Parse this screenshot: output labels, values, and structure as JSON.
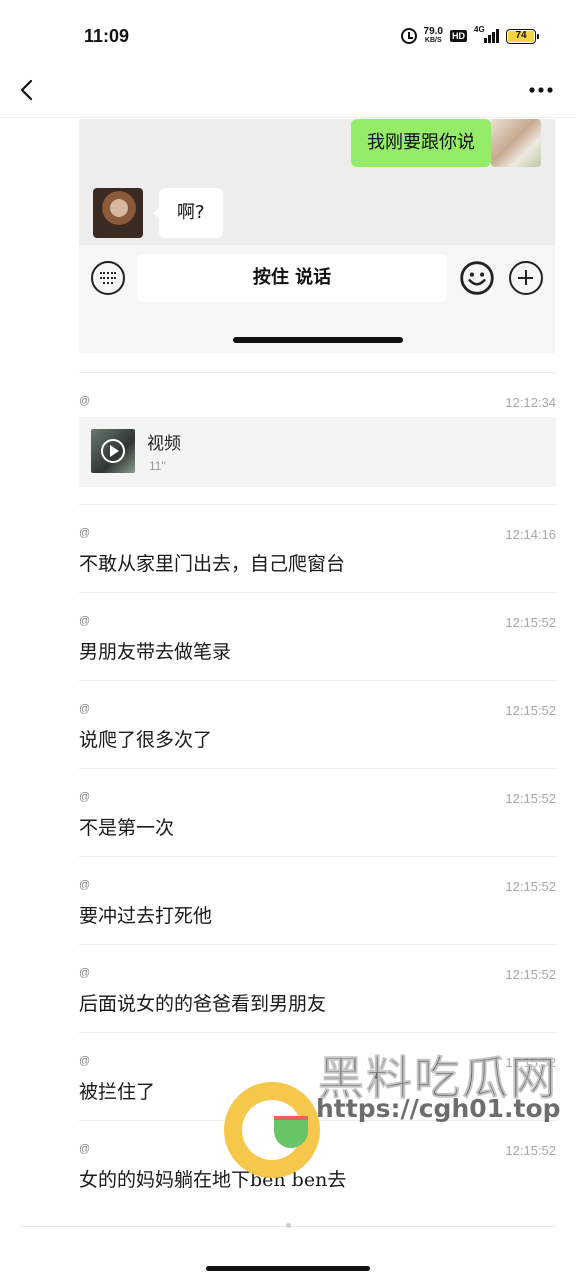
{
  "status_bar": {
    "time": "11:09",
    "net_speed": "79.0",
    "net_unit": "KB/S",
    "hd_badge": "HD",
    "network_type": "4G",
    "battery": "74"
  },
  "icons": {
    "back": "chevron-left-icon",
    "more": "more-dots-icon",
    "keyboard": "keyboard-icon",
    "emoji": "emoji-icon",
    "plus": "plus-icon",
    "play": "play-icon"
  },
  "embedded_screenshot": {
    "outgoing_message": "我刚要跟你说",
    "incoming_message": "啊?",
    "hold_to_talk": "按住 说话"
  },
  "records": [
    {
      "sender": "@",
      "time": "12:12:34",
      "type": "video",
      "video_title": "视频",
      "video_duration": "11\""
    },
    {
      "sender": "@",
      "time": "12:14:16",
      "text": "不敢从家里门出去，自己爬窗台"
    },
    {
      "sender": "@",
      "time": "12:15:52",
      "text": "男朋友带去做笔录"
    },
    {
      "sender": "@",
      "time": "12:15:52",
      "text": "说爬了很多次了"
    },
    {
      "sender": "@",
      "time": "12:15:52",
      "text": "不是第一次"
    },
    {
      "sender": "@",
      "time": "12:15:52",
      "text": "要冲过去打死他"
    },
    {
      "sender": "@",
      "time": "12:15:52",
      "text": "后面说女的的爸爸看到男朋友"
    },
    {
      "sender": "@",
      "time": "12:15:52",
      "text": "被拦住了"
    },
    {
      "sender": "@",
      "time": "12:15:52",
      "text": "女的的妈妈躺在地下ben ben去"
    }
  ],
  "watermark": {
    "title": "黑料吃瓜网",
    "url": "https://cgh01.top"
  },
  "colors": {
    "outgoing_bubble": "#95ec69",
    "watermark_logo": "#f5c33b",
    "battery_fill": "#f5d442"
  }
}
